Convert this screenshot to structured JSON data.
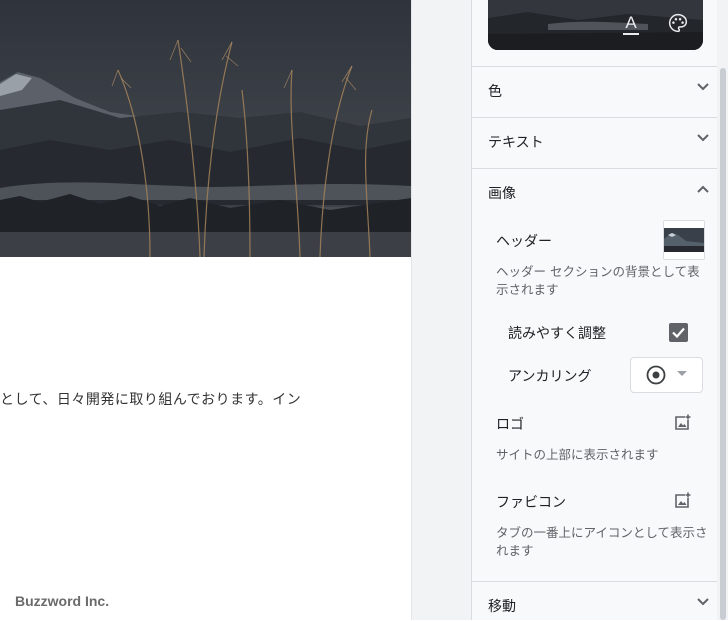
{
  "preview": {
    "body_text": "として、日々開発に取り組んでおります。イン",
    "footer_company": "Buzzword Inc."
  },
  "panel": {
    "theme_text_icon": "A",
    "sections": {
      "color": {
        "title": "色",
        "expanded": false
      },
      "text": {
        "title": "テキスト",
        "expanded": false
      },
      "image": {
        "title": "画像",
        "expanded": true
      },
      "navigation": {
        "title": "移動",
        "expanded": false
      }
    },
    "image_section": {
      "header_label": "ヘッダー",
      "header_desc": "ヘッダー セクションの背景として表示されます",
      "readability_label": "読みやすく調整",
      "readability_checked": true,
      "anchoring_label": "アンカリング",
      "logo_label": "ロゴ",
      "logo_desc": "サイトの上部に表示されます",
      "favicon_label": "ファビコン",
      "favicon_desc": "タブの一番上にアイコンとして表示されます"
    }
  },
  "icons": {
    "expand": "chevron-down-icon",
    "collapse": "chevron-up-icon",
    "add_image": "add-image-icon",
    "palette": "palette-icon",
    "radio": "radio-icon",
    "dropdown": "caret-down-icon"
  },
  "colors": {
    "panel_bg": "#f8f9fa",
    "gutter_bg": "#f1f3f4",
    "checkbox": "#5f6368"
  }
}
